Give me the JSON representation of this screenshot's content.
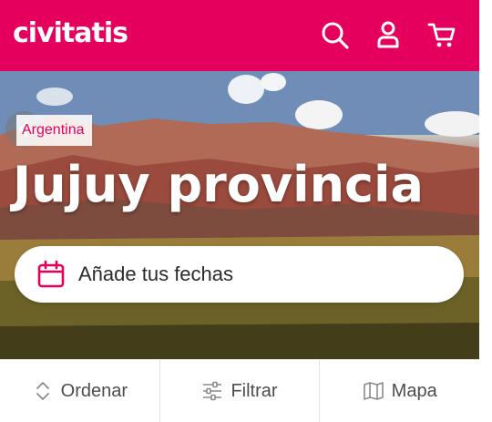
{
  "header": {
    "logo": "civitatis",
    "icons": [
      "search-icon",
      "user-icon",
      "cart-icon"
    ],
    "brand_color": "#e5005e"
  },
  "hero": {
    "tag": "Argentina",
    "title": "Jujuy provincia",
    "date_placeholder": "Añade tus fechas"
  },
  "bottom_bar": {
    "sort_label": "Ordenar",
    "filter_label": "Filtrar",
    "map_label": "Mapa"
  }
}
